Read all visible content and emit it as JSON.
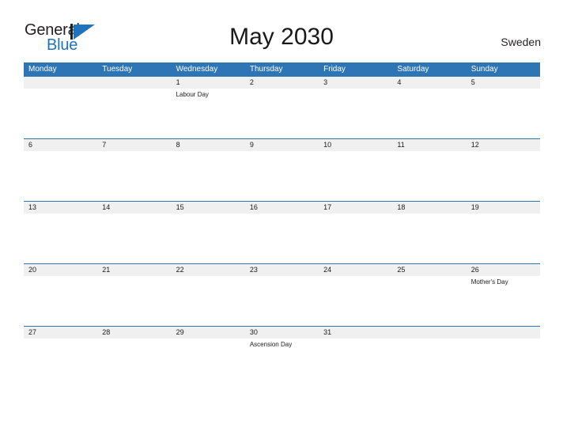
{
  "brand": {
    "word_one": "General",
    "word_two": "Blue",
    "mark_icon": "triangle-logo-icon",
    "accent_color": "#1e73be",
    "dark_color": "#231f20"
  },
  "header": {
    "title": "May 2030",
    "country": "Sweden"
  },
  "calendar": {
    "header_color": "#2e75b6",
    "strip_color": "#f0f0f0",
    "weekdays": [
      "Monday",
      "Tuesday",
      "Wednesday",
      "Thursday",
      "Friday",
      "Saturday",
      "Sunday"
    ],
    "weeks": [
      {
        "days": [
          {
            "num": "",
            "event": ""
          },
          {
            "num": "",
            "event": ""
          },
          {
            "num": "1",
            "event": "Labour Day"
          },
          {
            "num": "2",
            "event": ""
          },
          {
            "num": "3",
            "event": ""
          },
          {
            "num": "4",
            "event": ""
          },
          {
            "num": "5",
            "event": ""
          }
        ]
      },
      {
        "days": [
          {
            "num": "6",
            "event": ""
          },
          {
            "num": "7",
            "event": ""
          },
          {
            "num": "8",
            "event": ""
          },
          {
            "num": "9",
            "event": ""
          },
          {
            "num": "10",
            "event": ""
          },
          {
            "num": "11",
            "event": ""
          },
          {
            "num": "12",
            "event": ""
          }
        ]
      },
      {
        "days": [
          {
            "num": "13",
            "event": ""
          },
          {
            "num": "14",
            "event": ""
          },
          {
            "num": "15",
            "event": ""
          },
          {
            "num": "16",
            "event": ""
          },
          {
            "num": "17",
            "event": ""
          },
          {
            "num": "18",
            "event": ""
          },
          {
            "num": "19",
            "event": ""
          }
        ]
      },
      {
        "days": [
          {
            "num": "20",
            "event": ""
          },
          {
            "num": "21",
            "event": ""
          },
          {
            "num": "22",
            "event": ""
          },
          {
            "num": "23",
            "event": ""
          },
          {
            "num": "24",
            "event": ""
          },
          {
            "num": "25",
            "event": ""
          },
          {
            "num": "26",
            "event": "Mother's Day"
          }
        ]
      },
      {
        "days": [
          {
            "num": "27",
            "event": ""
          },
          {
            "num": "28",
            "event": ""
          },
          {
            "num": "29",
            "event": ""
          },
          {
            "num": "30",
            "event": "Ascension Day"
          },
          {
            "num": "31",
            "event": ""
          },
          {
            "num": "",
            "event": ""
          },
          {
            "num": "",
            "event": ""
          }
        ]
      }
    ]
  }
}
